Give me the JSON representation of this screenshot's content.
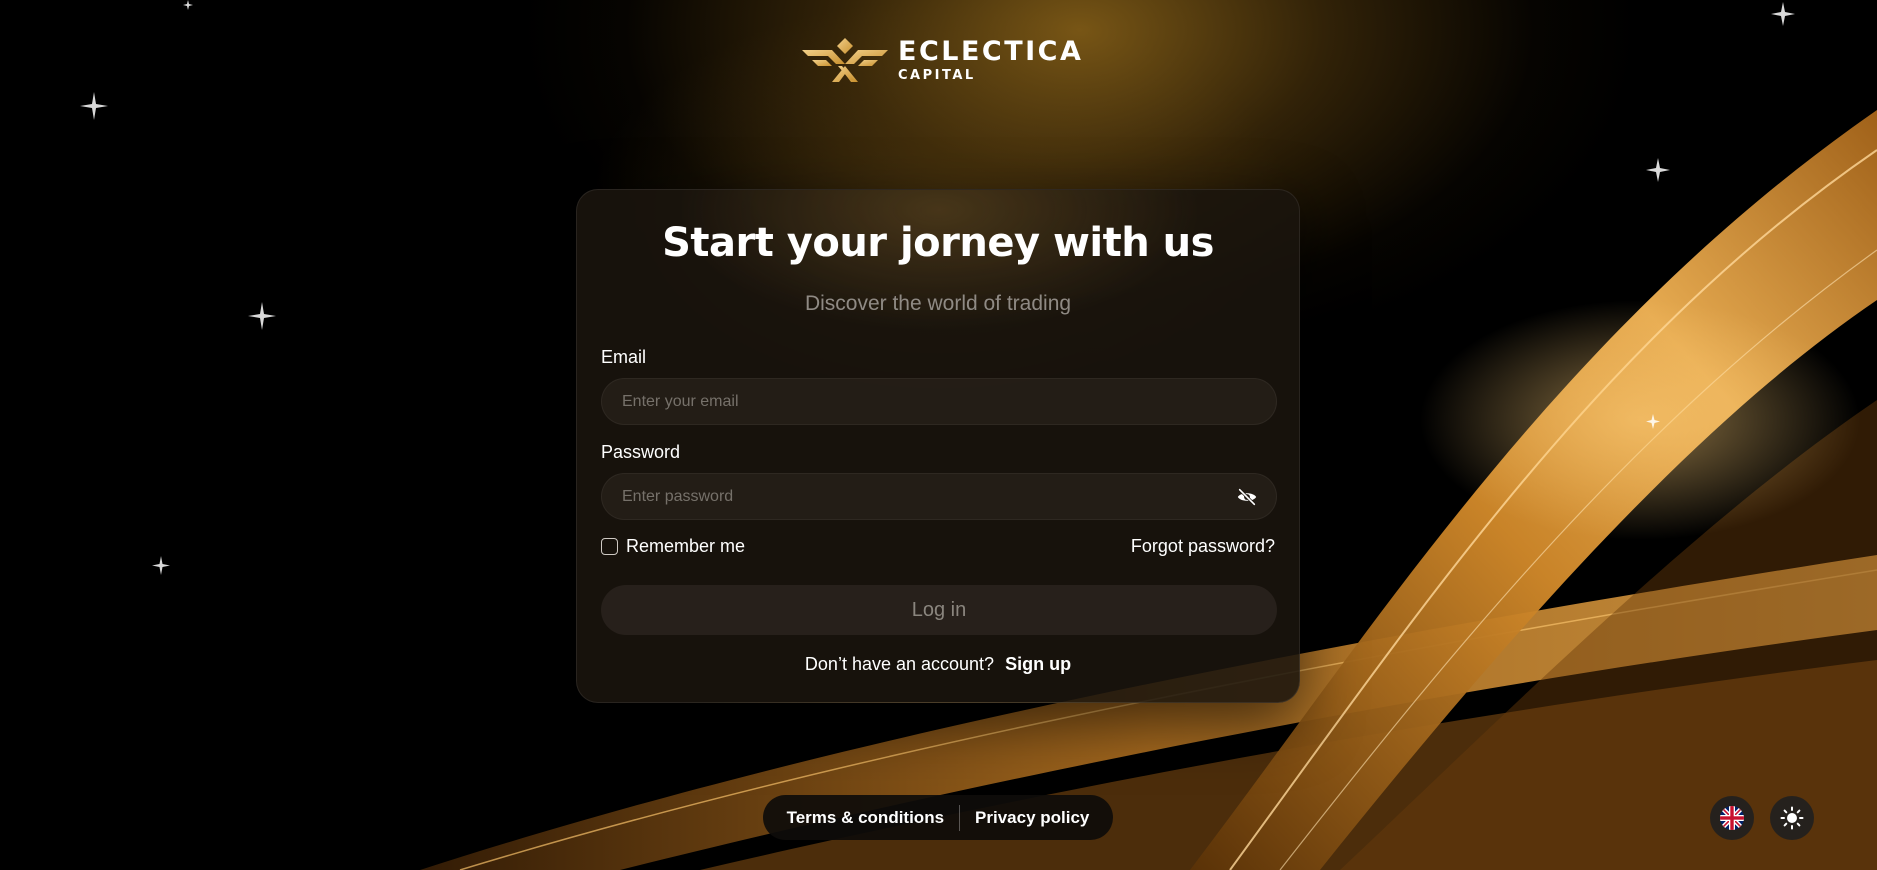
{
  "brand": {
    "name": "ECLECTICA",
    "subname": "CAPITAL",
    "logo_icon": "eclectica-wings-logo",
    "accent_color": "#d9a441"
  },
  "login_card": {
    "title": "Start your jorney with us",
    "subtitle": "Discover the world of trading",
    "email": {
      "label": "Email",
      "placeholder": "Enter your email",
      "value": ""
    },
    "password": {
      "label": "Password",
      "placeholder": "Enter password",
      "value": "",
      "toggle_icon": "eye-off-icon"
    },
    "remember_me": {
      "label": "Remember me",
      "checked": false
    },
    "forgot_password": "Forgot password?",
    "login_button": "Log in",
    "signup_prompt": "Don’t have an account?",
    "signup_link": "Sign up"
  },
  "footer": {
    "terms": "Terms & conditions",
    "privacy": "Privacy policy"
  },
  "controls": {
    "language_icon": "uk-flag-icon",
    "theme_icon": "sun-icon"
  }
}
